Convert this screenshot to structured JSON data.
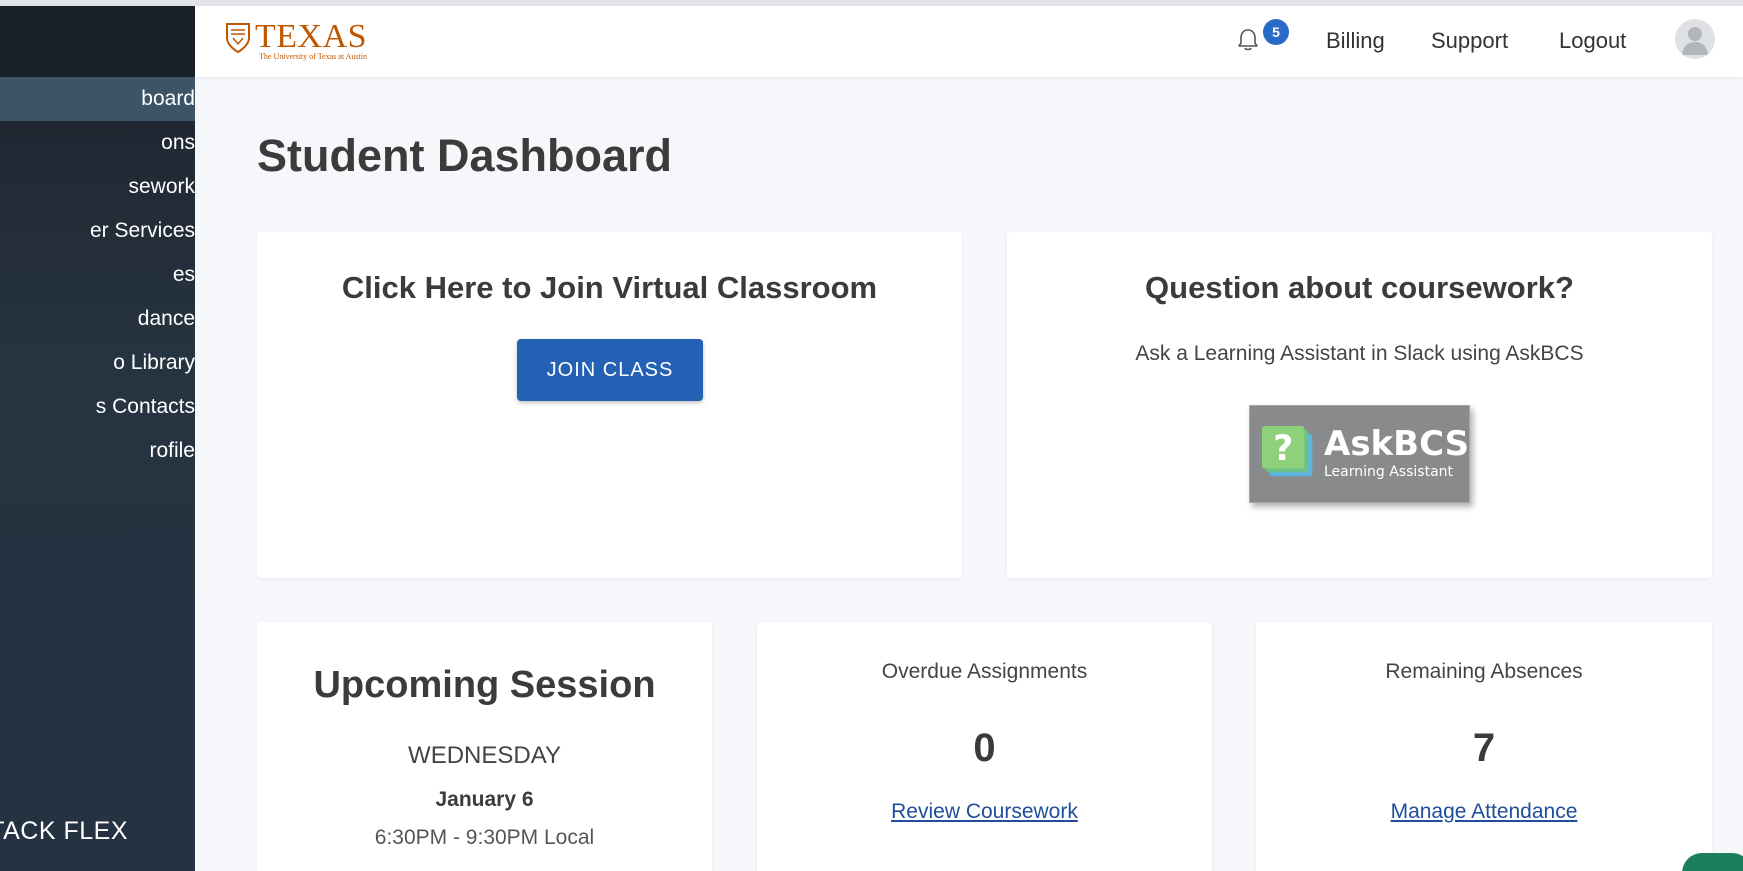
{
  "sidebar": {
    "items": [
      {
        "label": "board",
        "active": true
      },
      {
        "label": "ons"
      },
      {
        "label": "sework"
      },
      {
        "label": "er Services"
      },
      {
        "label": "es"
      },
      {
        "label": "dance"
      },
      {
        "label": "o Library"
      },
      {
        "label": "s Contacts"
      },
      {
        "label": "rofile"
      }
    ],
    "footer": "TACK FLEX"
  },
  "header": {
    "logo_word": "TEXAS",
    "logo_sub": "The University of Texas at Austin",
    "notifications_count": "5",
    "links": [
      "Billing",
      "Support",
      "Logout"
    ]
  },
  "main": {
    "title": "Student Dashboard",
    "virtual_classroom": {
      "title": "Click Here to Join Virtual Classroom",
      "button": "JOIN CLASS"
    },
    "question": {
      "title": "Question about coursework?",
      "text": "Ask a Learning Assistant in Slack using AskBCS",
      "badge_title": "AskBCS",
      "badge_sub": "Learning Assistant"
    },
    "upcoming": {
      "title": "Upcoming Session",
      "day": "WEDNESDAY",
      "date": "January 6",
      "time": "6:30PM - 9:30PM Local"
    },
    "overdue": {
      "label": "Overdue Assignments",
      "value": "0",
      "link": "Review Coursework"
    },
    "absences": {
      "label": "Remaining Absences",
      "value": "7",
      "link": "Manage Attendance"
    }
  },
  "colors": {
    "sidebar": "#243242",
    "primary_button": "#2460b4",
    "brand": "#bf5700",
    "badge": "#2a6ac7"
  },
  "icons": [
    "bell-icon",
    "avatar-icon",
    "texas-shield-icon",
    "askbcs-question-icon"
  ]
}
